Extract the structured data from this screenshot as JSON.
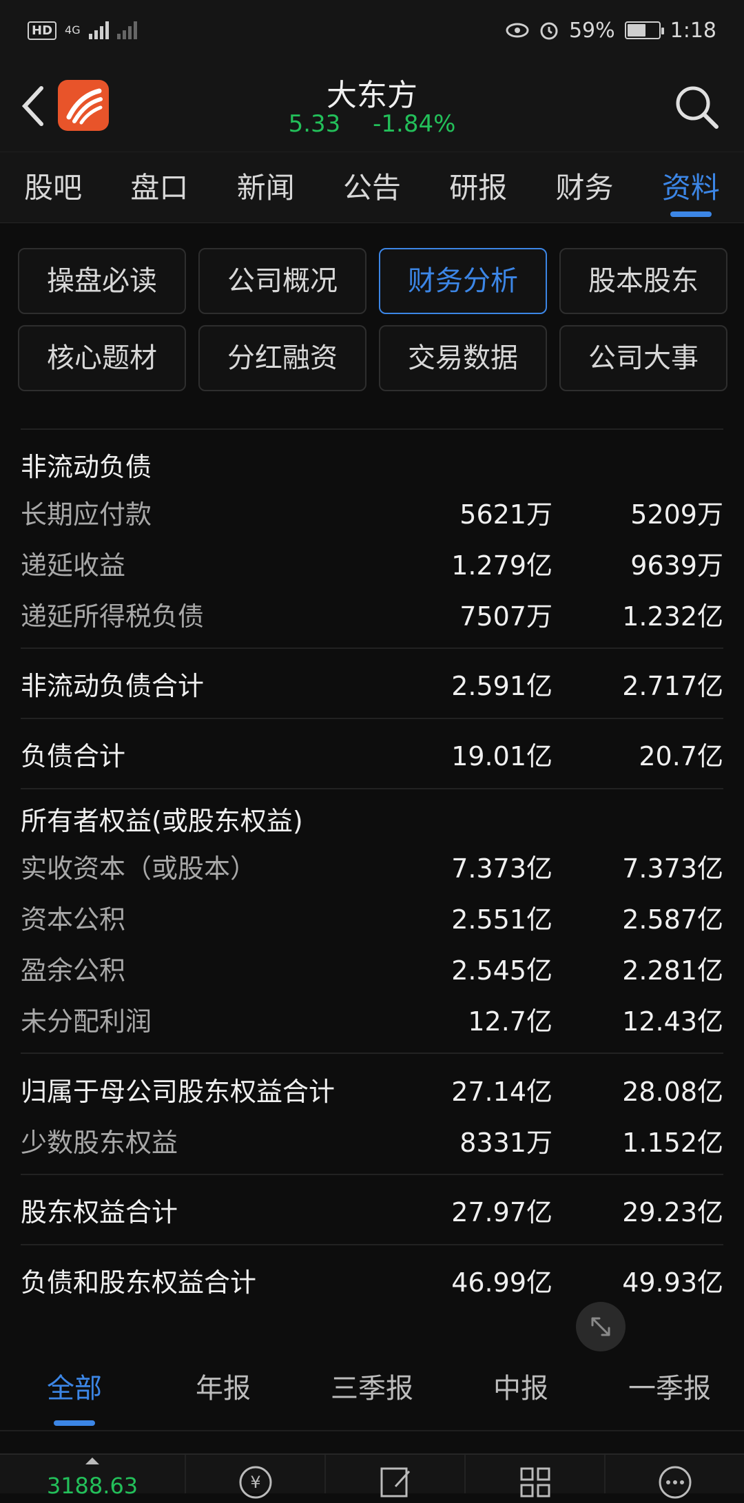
{
  "status_bar": {
    "hd": "HD",
    "network": "4G",
    "battery_percent": "59%",
    "battery_level": 0.59,
    "time": "1:18"
  },
  "header": {
    "title": "大东方",
    "price": "5.33",
    "change": "-1.84%",
    "quote_color": "#23c05a"
  },
  "tabs": [
    "股吧",
    "盘口",
    "新闻",
    "公告",
    "研报",
    "财务",
    "资料"
  ],
  "active_tab": "资料",
  "sub_buttons": [
    "操盘必读",
    "公司概况",
    "财务分析",
    "股本股东",
    "核心题材",
    "分红融资",
    "交易数据",
    "公司大事"
  ],
  "active_sub": "财务分析",
  "table": {
    "section_noncurrent": "非流动负债",
    "rows_noncurrent": [
      {
        "label": "长期应付款",
        "v1": "5621万",
        "v2": "5209万"
      },
      {
        "label": "递延收益",
        "v1": "1.279亿",
        "v2": "9639万"
      },
      {
        "label": "递延所得税负债",
        "v1": "7507万",
        "v2": "1.232亿"
      }
    ],
    "total_noncurrent": {
      "label": "非流动负债合计",
      "v1": "2.591亿",
      "v2": "2.717亿"
    },
    "total_liabilities": {
      "label": "负债合计",
      "v1": "19.01亿",
      "v2": "20.7亿"
    },
    "section_equity": "所有者权益(或股东权益)",
    "rows_equity": [
      {
        "label": "实收资本（或股本）",
        "v1": "7.373亿",
        "v2": "7.373亿"
      },
      {
        "label": "资本公积",
        "v1": "2.551亿",
        "v2": "2.587亿"
      },
      {
        "label": "盈余公积",
        "v1": "2.545亿",
        "v2": "2.281亿"
      },
      {
        "label": "未分配利润",
        "v1": "12.7亿",
        "v2": "12.43亿"
      }
    ],
    "parent_equity": {
      "label": "归属于母公司股东权益合计",
      "v1": "27.14亿",
      "v2": "28.08亿"
    },
    "minority_equity": {
      "label": "少数股东权益",
      "v1": "8331万",
      "v2": "1.152亿"
    },
    "total_equity": {
      "label": "股东权益合计",
      "v1": "27.97亿",
      "v2": "29.23亿"
    },
    "total_liab_equity": {
      "label": "负债和股东权益合计",
      "v1": "46.99亿",
      "v2": "49.93亿"
    }
  },
  "period_tabs": [
    "全部",
    "年报",
    "三季报",
    "中报",
    "一季报"
  ],
  "active_period": "全部",
  "bottom_nav": {
    "index_value": "3188.63",
    "icons": [
      "exchange-yen-icon",
      "edit-note-icon",
      "grid-apps-icon",
      "more-dots-icon"
    ]
  },
  "accent_color": "#3c86e6"
}
